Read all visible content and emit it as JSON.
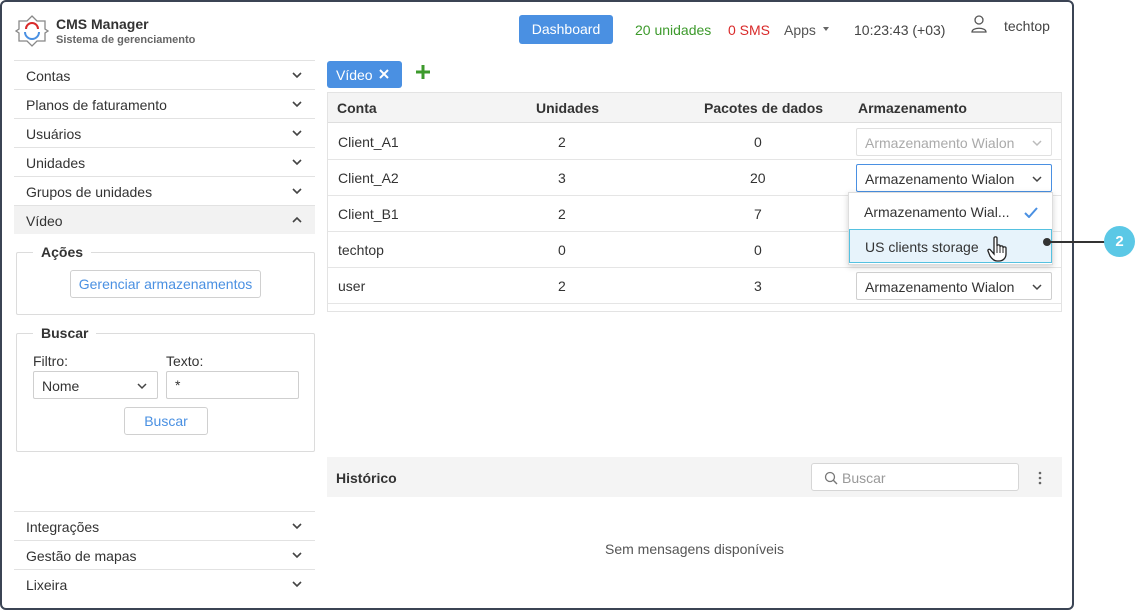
{
  "header": {
    "app_title": "CMS Manager",
    "app_subtitle": "Sistema de gerenciamento",
    "dashboard_label": "Dashboard",
    "units_count": "20 unidades",
    "sms_count": "0 SMS",
    "apps_label": "Apps",
    "clock": "10:23:43 (+03)",
    "user_name": "techtop"
  },
  "sidebar": {
    "items": [
      {
        "label": "Contas"
      },
      {
        "label": "Planos de faturamento"
      },
      {
        "label": "Usuários"
      },
      {
        "label": "Unidades"
      },
      {
        "label": "Grupos de unidades"
      },
      {
        "label": "Vídeo"
      }
    ],
    "actions": {
      "legend": "Ações",
      "manage_storage_button": "Gerenciar armazenamentos"
    },
    "search": {
      "legend": "Buscar",
      "filter_label": "Filtro:",
      "text_label": "Texto:",
      "filter_value": "Nome",
      "text_value": "*",
      "search_button": "Buscar"
    },
    "bottom_items": [
      {
        "label": "Integrações"
      },
      {
        "label": "Gestão de mapas"
      },
      {
        "label": "Lixeira"
      }
    ]
  },
  "tabs": {
    "video_label": "Vídeo"
  },
  "table": {
    "columns": [
      "Conta",
      "Unidades",
      "Pacotes de dados",
      "Armazenamento"
    ],
    "rows": [
      {
        "account": "Client_A1",
        "units": "2",
        "packages": "0",
        "storage": "Armazenamento Wialon",
        "state": "disabled"
      },
      {
        "account": "Client_A2",
        "units": "3",
        "packages": "20",
        "storage": "Armazenamento Wialon",
        "state": "open"
      },
      {
        "account": "Client_B1",
        "units": "2",
        "packages": "7",
        "storage": "",
        "state": "hidden"
      },
      {
        "account": "techtop",
        "units": "0",
        "packages": "0",
        "storage": "",
        "state": "hidden"
      },
      {
        "account": "user",
        "units": "2",
        "packages": "3",
        "storage": "Armazenamento Wialon",
        "state": "normal"
      }
    ]
  },
  "dropdown": {
    "options": [
      "Armazenamento Wial...",
      "US clients storage"
    ]
  },
  "history": {
    "title": "Histórico",
    "search_placeholder": "Buscar",
    "empty_message": "Sem mensagens disponíveis"
  },
  "callout": {
    "number": "2"
  },
  "colors": {
    "accent": "#4a90e2",
    "units_green": "#3d9a2c",
    "sms_red": "#d92a2a",
    "callout": "#5bc8e6",
    "hover_bg": "#e7f3fb"
  }
}
